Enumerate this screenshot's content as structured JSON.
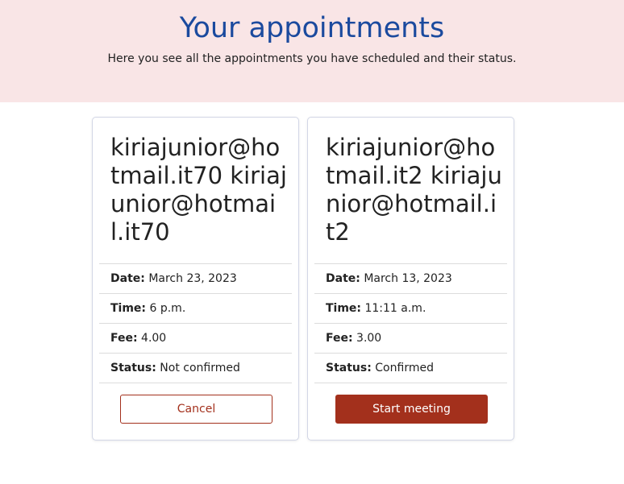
{
  "header": {
    "title": "Your appointments",
    "subtitle": "Here you see all the appointments you have scheduled and their status."
  },
  "appointments": [
    {
      "title": "kiriajunior@hotmail.it70 kiriajunior@hotmail.it70",
      "date_label": "Date:",
      "date": "March 23, 2023",
      "time_label": "Time:",
      "time": "6 p.m.",
      "fee_label": "Fee:",
      "fee": "4.00",
      "status_label": "Status:",
      "status": "Not confirmed",
      "action": "Cancel"
    },
    {
      "title": "kiriajunior@hotmail.it2 kiriajunior@hotmail.it2",
      "date_label": "Date:",
      "date": "March 13, 2023",
      "time_label": "Time:",
      "time": "11:11 a.m.",
      "fee_label": "Fee:",
      "fee": "3.00",
      "status_label": "Status:",
      "status": "Confirmed",
      "action": "Start meeting"
    }
  ],
  "colors": {
    "header_bg": "#f9e5e6",
    "title": "#1b4a9e",
    "accent": "#a3301c"
  }
}
